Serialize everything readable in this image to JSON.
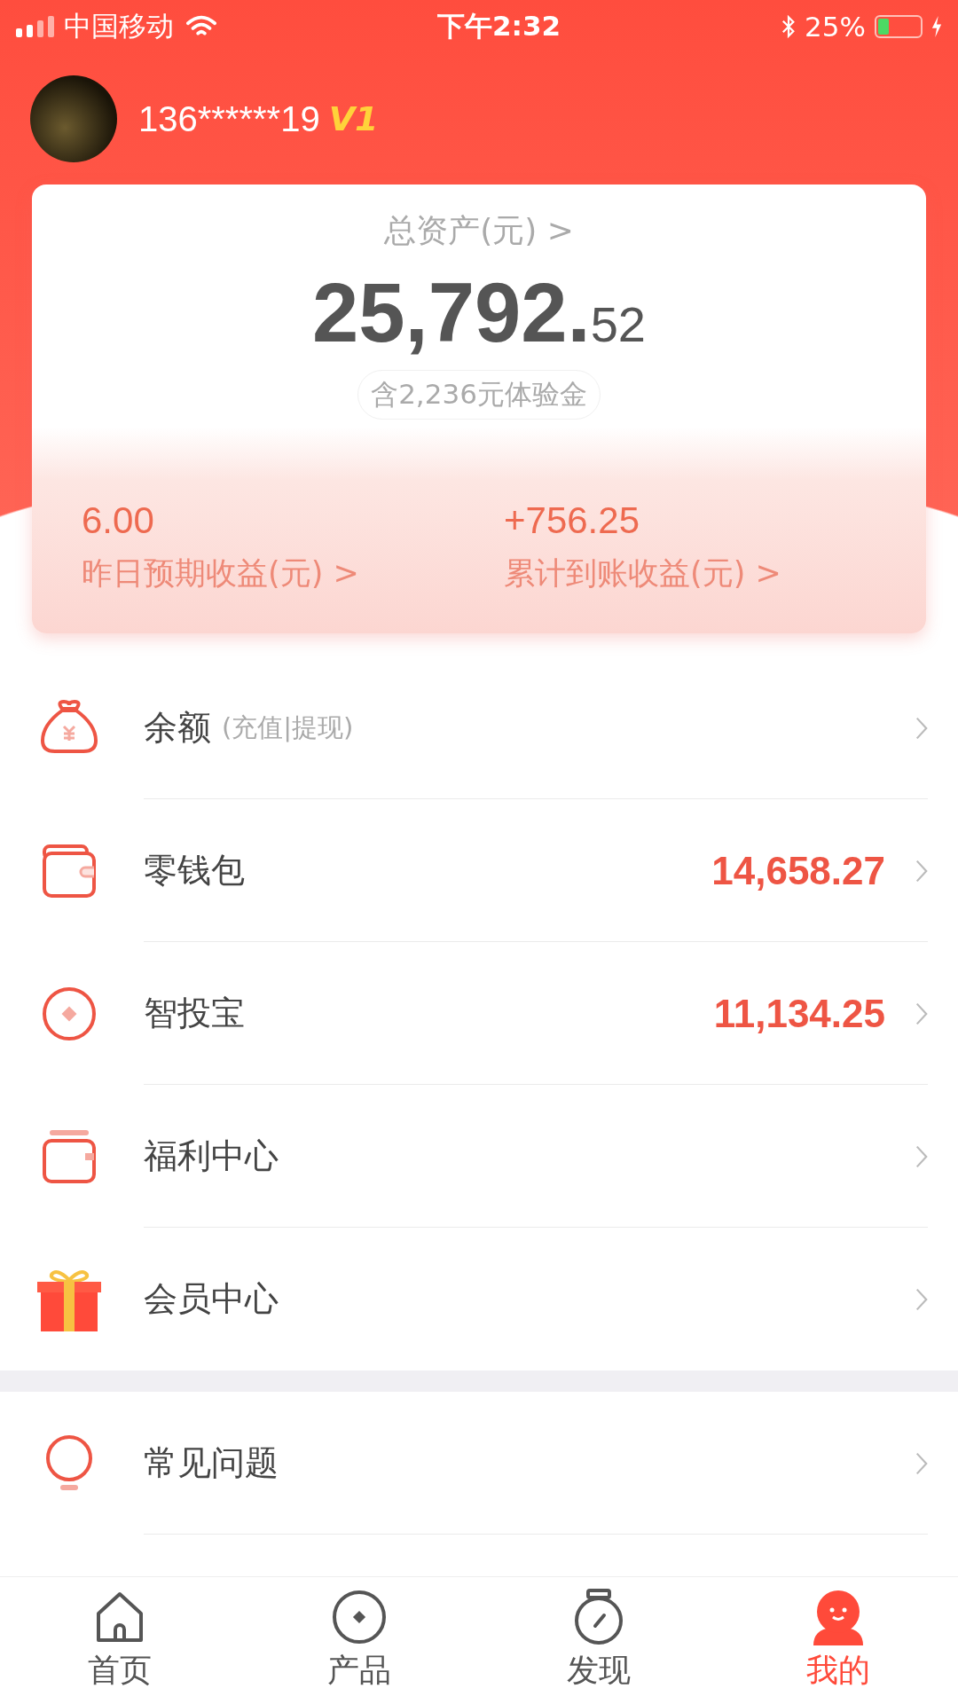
{
  "status_bar": {
    "carrier": "中国移动",
    "time": "下午2:32",
    "battery": "25%"
  },
  "profile": {
    "phone": "136******19",
    "vip": "V1"
  },
  "assets": {
    "title": "总资产(元)",
    "chevron": ">",
    "integer": "25,792.",
    "decimals": "52",
    "note": "含2,236元体验金",
    "stats": [
      {
        "value": "6.00",
        "label": "昨日预期收益(元)",
        "chevron": ">"
      },
      {
        "value": "+756.25",
        "label": "累计到账收益(元)",
        "chevron": ">"
      }
    ]
  },
  "menu": [
    {
      "label": "余额",
      "sub": "(充值|提现)"
    },
    {
      "label": "零钱包",
      "value": "14,658.27"
    },
    {
      "label": "智投宝",
      "value": "11,134.25"
    },
    {
      "label": "福利中心"
    },
    {
      "label": "会员中心"
    }
  ],
  "menu2": [
    {
      "label": "常见问题"
    }
  ],
  "tabs": [
    {
      "label": "首页",
      "selected": false
    },
    {
      "label": "产品",
      "selected": false
    },
    {
      "label": "发现",
      "selected": false
    },
    {
      "label": "我的",
      "selected": true
    }
  ]
}
